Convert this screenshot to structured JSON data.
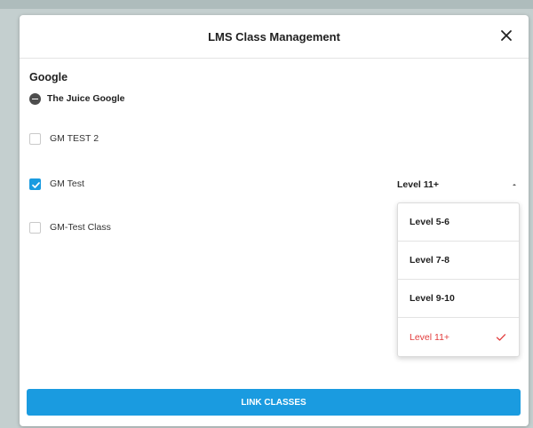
{
  "modal": {
    "title": "LMS Class Management",
    "close_icon": "close-icon"
  },
  "group": {
    "name": "Google",
    "organization": {
      "label": "The Juice Google",
      "icon": "minus-circle-icon"
    }
  },
  "classes": [
    {
      "label": "GM TEST 2",
      "checked": false
    },
    {
      "label": "GM Test",
      "checked": true,
      "level": "Level 11+"
    },
    {
      "label": "GM-Test Class",
      "checked": false
    }
  ],
  "level_select": {
    "value": "Level 11+",
    "expanded": true,
    "options": [
      {
        "label": "Level 5-6"
      },
      {
        "label": "Level 7-8"
      },
      {
        "label": "Level 9-10"
      },
      {
        "label": "Level 11+",
        "selected": true
      }
    ]
  },
  "actions": {
    "link_classes": "LINK CLASSES"
  },
  "colors": {
    "accent": "#1a9be0",
    "selected_option": "#e23c3c",
    "backdrop": "#c4cfcf"
  }
}
